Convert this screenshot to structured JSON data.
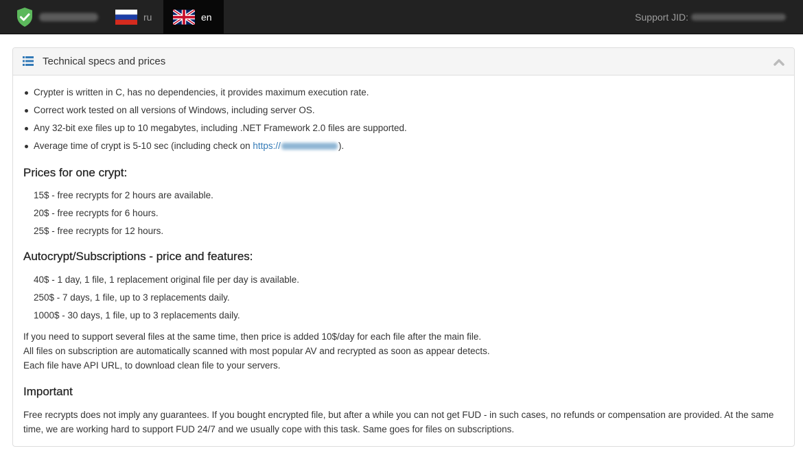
{
  "navbar": {
    "brand_icon": "shield-check-icon",
    "languages": [
      {
        "code": "ru",
        "label": "ru",
        "flag": "russia-flag-icon"
      },
      {
        "code": "en",
        "label": "en",
        "flag": "uk-flag-icon",
        "active": true
      }
    ],
    "support_label": "Support JID:"
  },
  "panel": {
    "icon": "list-icon",
    "title": "Technical specs and prices",
    "collapse_icon": "chevron-up-icon",
    "features": [
      "Crypter is written in C, has no dependencies, it provides maximum execution rate.",
      "Correct work tested on all versions of Windows, including server OS.",
      "Any 32-bit exe files up to 10 megabytes, including .NET Framework 2.0 files are supported.",
      "Average time of crypt is 5-10 sec (including check on "
    ],
    "feature_link_text": "https://",
    "feature_tail": ").",
    "prices_heading": "Prices for one crypt:",
    "prices": [
      "15$ - free recrypts for 2 hours are available.",
      "20$ - free recrypts for 6 hours.",
      "25$ - free recrypts for 12 hours."
    ],
    "subs_heading": "Autocrypt/Subscriptions - price and features:",
    "subscriptions": [
      "40$ - 1 day, 1 file, 1 replacement original file per day is available.",
      "250$ - 7 days, 1 file, up to 3 replacements daily.",
      "1000$ - 30 days, 1 file, up to 3 replacements daily."
    ],
    "info_lines": [
      "If you need to support several files at the same time, then price is added 10$/day for each file after the main file.",
      "All files on subscription are automatically scanned with most popular AV and recrypted as soon as appear detects.",
      "Each file have API URL, to download clean file to your servers."
    ],
    "important_heading": "Important",
    "important_text": "Free recrypts does not imply any guarantees. If you bought encrypted file, but after a while you can not get FUD - in such cases, no refunds or compensation are provided. At the same time, we are working hard to support FUD 24/7 and we usually cope with this task. Same goes for files on subscriptions."
  },
  "colors": {
    "navbar_bg": "#222222",
    "active_tab_bg": "#080808",
    "shield_green": "#5cb85c",
    "link": "#337ab7",
    "panel_heading_bg": "#f5f5f5"
  }
}
